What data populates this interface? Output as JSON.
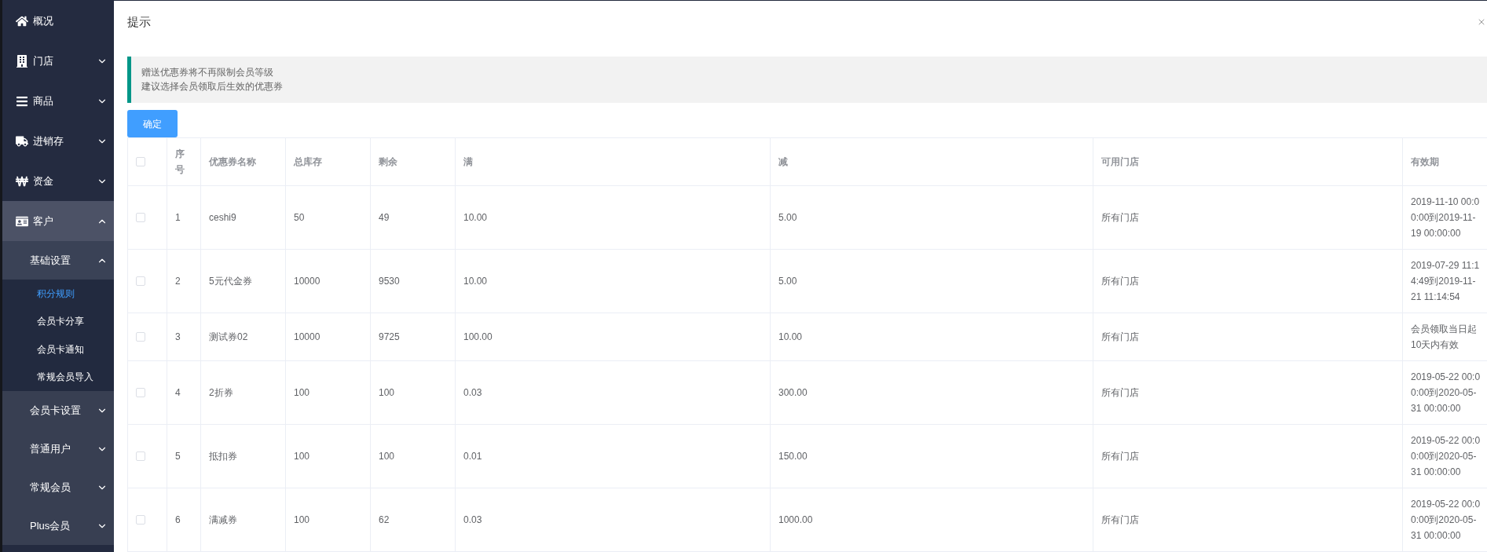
{
  "sidebar": {
    "items": [
      {
        "label": "概况",
        "kind": "link",
        "selected": false
      },
      {
        "label": "门店",
        "kind": "group",
        "expanded": false
      },
      {
        "label": "商品",
        "kind": "group",
        "expanded": false
      },
      {
        "label": "进销存",
        "kind": "group",
        "expanded": false
      },
      {
        "label": "资金",
        "kind": "group",
        "expanded": false
      },
      {
        "label": "客户",
        "kind": "group",
        "expanded": true,
        "children": [
          {
            "label": "基础设置",
            "kind": "group",
            "expanded": true,
            "children": [
              {
                "label": "积分规则",
                "selected": true
              },
              {
                "label": "会员卡分享",
                "selected": false
              },
              {
                "label": "会员卡通知",
                "selected": false
              },
              {
                "label": "常规会员导入",
                "selected": false
              }
            ]
          },
          {
            "label": "会员卡设置",
            "kind": "group",
            "expanded": false
          },
          {
            "label": "普通用户",
            "kind": "group",
            "expanded": false
          },
          {
            "label": "常规会员",
            "kind": "group",
            "expanded": false
          },
          {
            "label": "Plus会员",
            "kind": "group",
            "expanded": false
          }
        ]
      }
    ]
  },
  "dialog": {
    "title": "提示",
    "notice": [
      "赠送优惠券将不再限制会员等级",
      "建议选择会员领取后生效的优惠券"
    ],
    "confirm_button": "确定",
    "table": {
      "select_all": {
        "checked": false
      },
      "columns": [
        "序号",
        "优惠券名称",
        "总库存",
        "剩余",
        "满",
        "减",
        "可用门店",
        "有效期"
      ],
      "rows": [
        {
          "checked": false,
          "cells": [
            "1",
            "ceshi9",
            "50",
            "49",
            "10.00",
            "5.00",
            "所有门店",
            "2019-11-10 00:00:00到2019-11-19 00:00:00"
          ]
        },
        {
          "checked": false,
          "cells": [
            "2",
            "5元代金券",
            "10000",
            "9530",
            "10.00",
            "5.00",
            "所有门店",
            "2019-07-29 11:14:49到2019-11-21 11:14:54"
          ]
        },
        {
          "checked": false,
          "cells": [
            "3",
            "测试券02",
            "10000",
            "9725",
            "100.00",
            "10.00",
            "所有门店",
            "会员领取当日起10天内有效"
          ]
        },
        {
          "checked": false,
          "cells": [
            "4",
            "2折券",
            "100",
            "100",
            "0.03",
            "300.00",
            "所有门店",
            "2019-05-22 00:00:00到2020-05-31 00:00:00"
          ]
        },
        {
          "checked": false,
          "cells": [
            "5",
            "抵扣券",
            "100",
            "100",
            "0.01",
            "150.00",
            "所有门店",
            "2019-05-22 00:00:00到2020-05-31 00:00:00"
          ]
        },
        {
          "checked": false,
          "cells": [
            "6",
            "满减券",
            "100",
            "62",
            "0.03",
            "1000.00",
            "所有门店",
            "2019-05-22 00:00:00到2020-05-31 00:00:00"
          ]
        }
      ]
    }
  }
}
